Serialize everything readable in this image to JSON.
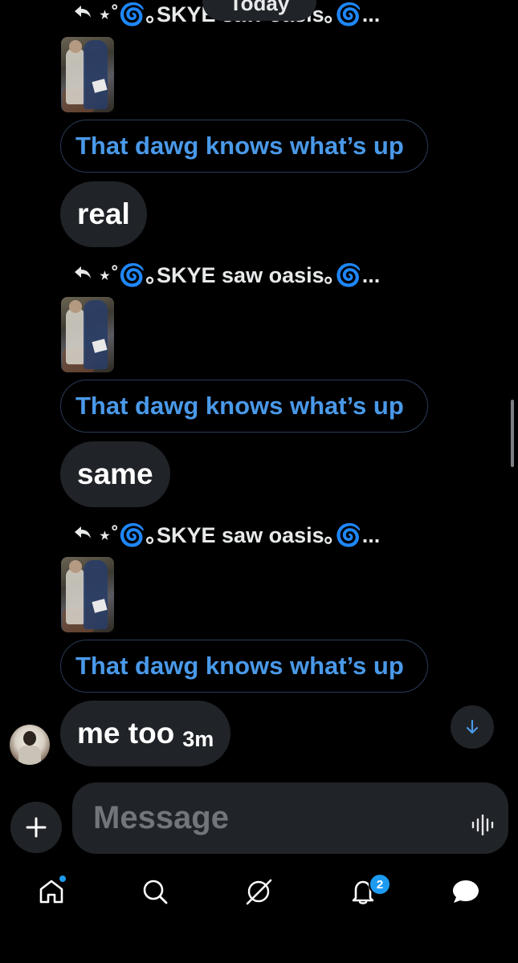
{
  "date_separator": "Today",
  "reply_header_text": "⋆˚🌀｡SKYE saw oasis｡🌀...",
  "quoted_text": "That dawg knows what’s up",
  "messages": [
    {
      "text": "real"
    },
    {
      "text": "same"
    },
    {
      "text": "me too",
      "time": "3m"
    }
  ],
  "composer": {
    "placeholder": "Message"
  },
  "nav": {
    "items": [
      "home-icon",
      "search-icon",
      "grok-icon",
      "notifications-icon",
      "messages-icon"
    ],
    "notification_count": "2"
  },
  "colors": {
    "background": "#000000",
    "bubble": "#202327",
    "accent": "#1d9bf0",
    "quote_text": "#4a99e9"
  }
}
